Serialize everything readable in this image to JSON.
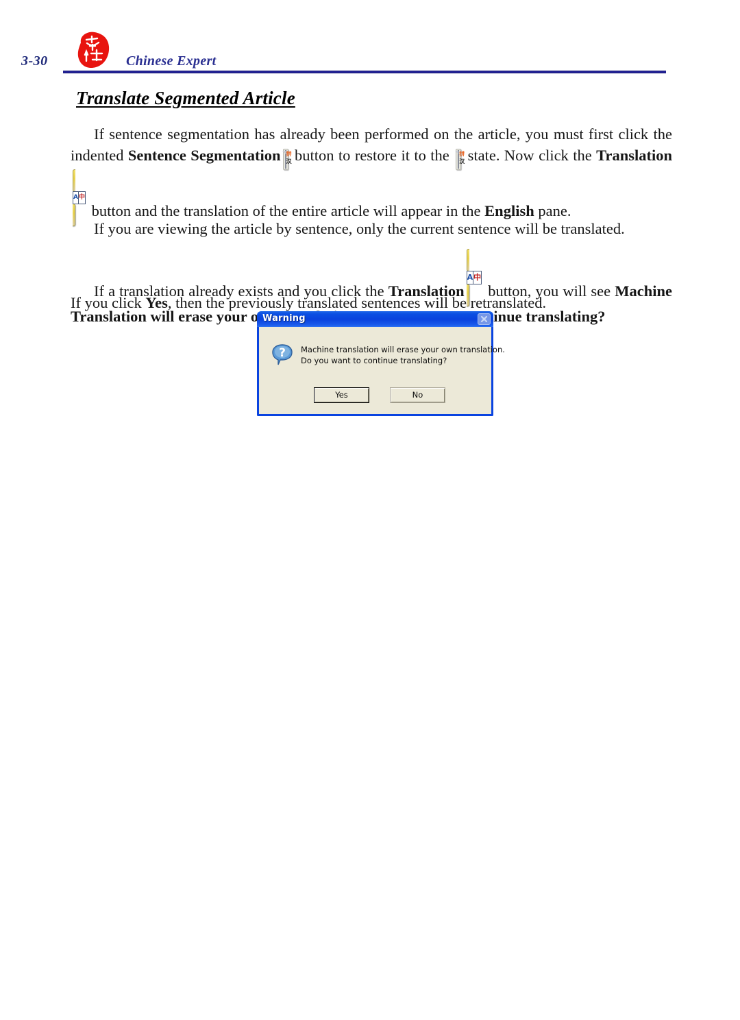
{
  "header": {
    "page_number": "3-30",
    "brand_name": "Chinese Expert",
    "logo_icon": "red-seal-chop-icon",
    "rule_color": "#26269b",
    "page_number_color": "#1f2a7a",
    "brand_color": "#2a2f91"
  },
  "section": {
    "heading": "Translate Segmented Article"
  },
  "paragraphs": {
    "p1": {
      "t1": "If sentence segmentation has already been performed on the article, you must first click the indented ",
      "b1": "Sentence Segmentation",
      "icon1": "sentence-segmentation-icon",
      "t2": " button to restore it to the ",
      "icon2": "sentence-segmentation-icon",
      "t3": " state. Now click the ",
      "b2": "Translation",
      "icon3": "translation-icon",
      "t4": " button and the translation of the entire article will appear in the ",
      "b3": "English",
      "t5": " pane."
    },
    "p2": {
      "t1": "If you are viewing the article by sentence, only the current sentence will  be translated."
    },
    "p3": {
      "t1": "If a translation already exists and you click the ",
      "b1": "Translation",
      "icon1": "translation-icon",
      "t2": " button, you will see ",
      "b2": "Machine Translation will erase your own translation. Do you want to continue translating?"
    },
    "p4": {
      "t1": "If you click ",
      "b1": "Yes",
      "t2": ", then the previously translated sentences will be retranslated."
    }
  },
  "icons": {
    "segmentation": {
      "name": "sentence-segmentation-icon",
      "top_glyph": "拼",
      "bottom_glyph": "汉",
      "top_color": "#e8601c",
      "bottom_color": "#2a2a2a"
    },
    "translation": {
      "name": "translation-icon",
      "left_glyph": "A",
      "right_glyph": "中",
      "left_color": "#1d4fa8",
      "right_color": "#c02020",
      "bezel_color": "#e8d24f"
    }
  },
  "warning_dialog": {
    "title": "Warning",
    "close_icon": "close-icon",
    "question_icon": "question-mark-icon",
    "message_line_1": "Machine translation will erase your own translation.",
    "message_line_2": "Do you want to continue translating?",
    "yes_label": "Yes",
    "no_label": "No",
    "titlebar_color": "#0a42dd",
    "body_color": "#ece9d8"
  }
}
